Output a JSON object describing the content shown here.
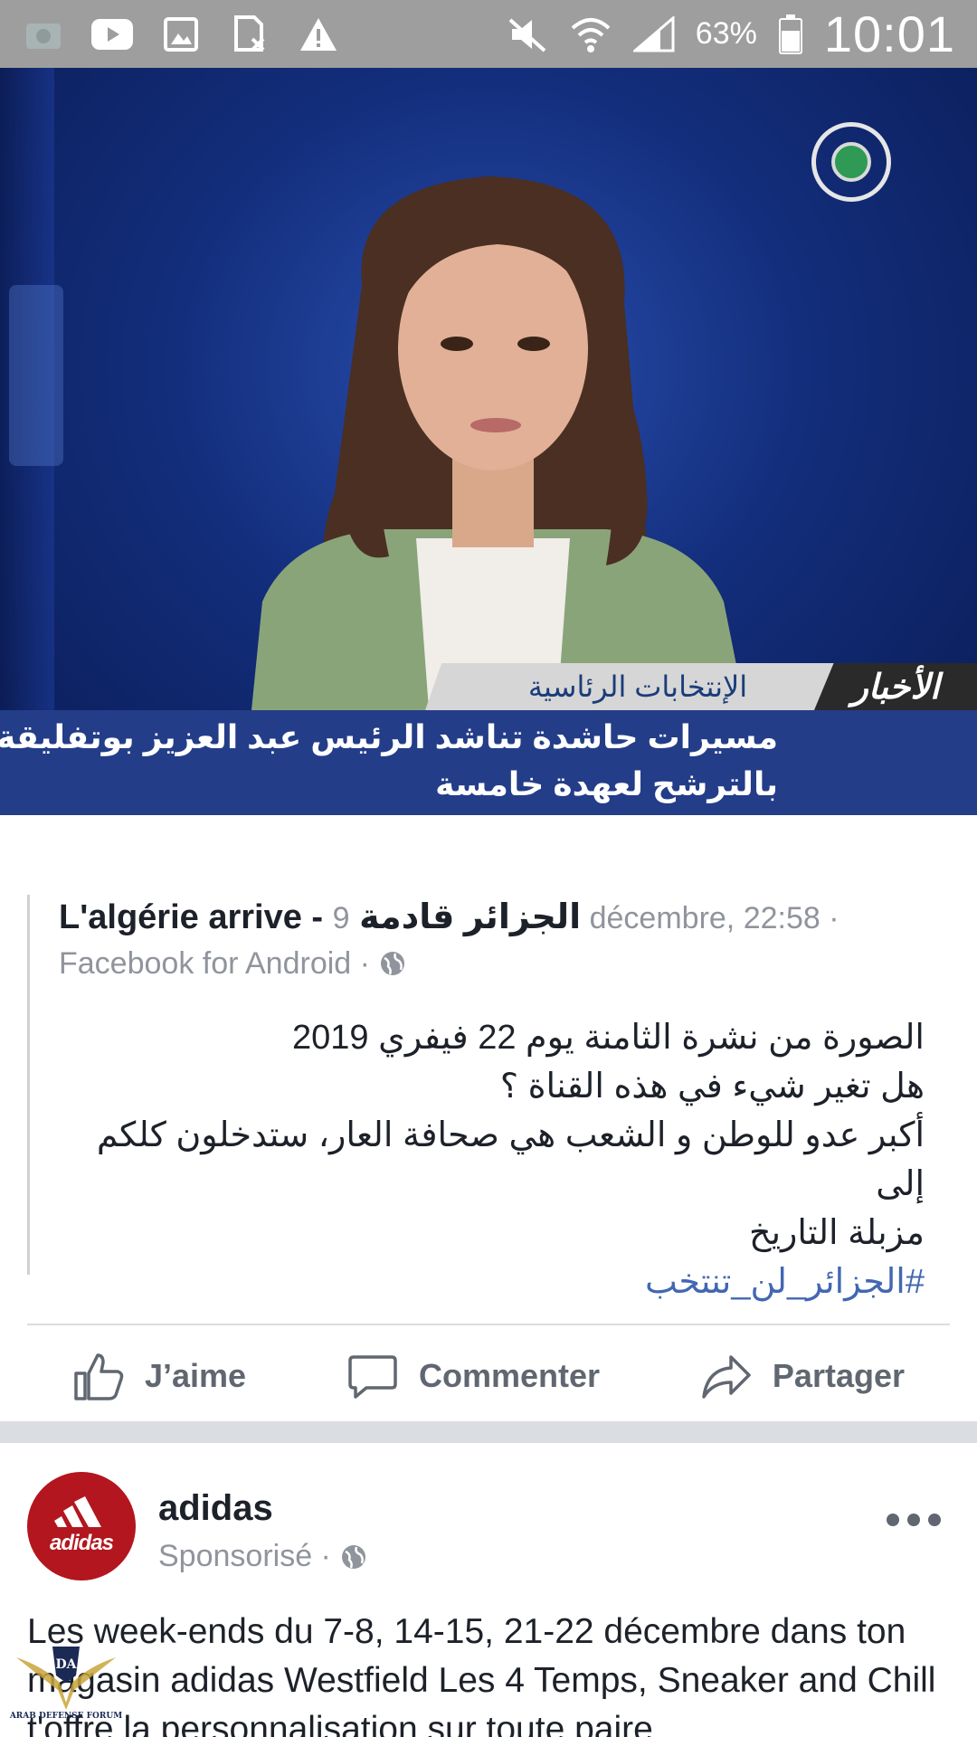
{
  "status_bar": {
    "left_icons": [
      "camera-icon",
      "youtube-icon",
      "gallery-icon",
      "no-sim-icon",
      "warning-icon"
    ],
    "right_icons": [
      "mute-icon",
      "wifi-icon",
      "signal-icon",
      "battery-icon"
    ],
    "battery": "63%",
    "time": "10:01"
  },
  "news_image": {
    "channel_tag": "الأخبار",
    "topic": "الإنتخابات الرئاسية",
    "headline_line1": "مسيرات حاشدة تناشد الرئيس عبد العزيز بوتفليقة",
    "headline_line2": "بالترشح لعهدة خامسة"
  },
  "post": {
    "author": "L'algérie arrive - الجزائر قادمة",
    "date": "9 décembre, 22:58 ·",
    "via": "Facebook for Android ·",
    "text_lines": [
      "الصورة من نشرة الثامنة يوم 22 فيفري 2019",
      "هل تغير شيء في هذه القناة ؟",
      "أكبر عدو للوطن و الشعب هي صحافة العار، ستدخلون كلكم إلى",
      "مزبلة التاريخ"
    ],
    "hashtag": "#الجزائر_لن_تنتخب",
    "actions": {
      "like": "J’aime",
      "comment": "Commenter",
      "share": "Partager"
    }
  },
  "ad": {
    "logo_word": "adidas",
    "name": "adidas",
    "sponsored": "Sponsorisé ·",
    "text": "Les week-ends du 7-8, 14-15, 21-22 décembre dans ton magasin adidas Westfield Les 4 Temps, Sneaker and Chill t'offre la personnalisation sur toute paire"
  },
  "watermark": {
    "text": "ARAB DEFENSE FORUM",
    "mark": "DA"
  },
  "colors": {
    "status_bar": "#9e9e9e",
    "link_blue": "#4267b2",
    "action_gray": "#606770",
    "adidas_red": "#b3161f"
  }
}
